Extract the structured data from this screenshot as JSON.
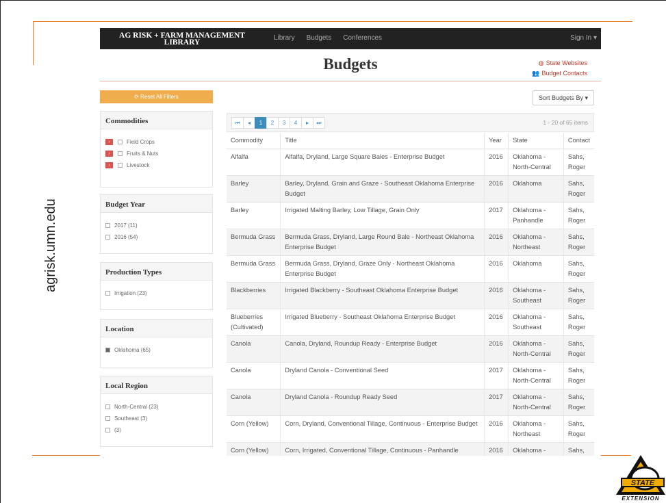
{
  "side_url": "agrisk.umn.edu",
  "logo": {
    "top": "STATE",
    "bottom": "EXTENSION",
    "mark": "O"
  },
  "navbar": {
    "brand_line1": "AG RISK + FARM MANAGEMENT",
    "brand_line2": "LIBRARY",
    "links": [
      "Library",
      "Budgets",
      "Conferences"
    ],
    "signin": "Sign In ▾"
  },
  "page": {
    "title": "Budgets",
    "state_websites": "State Websites",
    "budget_contacts": "Budget Contacts"
  },
  "sidebar": {
    "reset": "Reset All Filters",
    "commodities": {
      "title": "Commodities",
      "items": [
        "Field Crops",
        "Fruits & Nuts",
        "Livestock"
      ]
    },
    "budget_year": {
      "title": "Budget Year",
      "items": [
        "2017 (11)",
        "2016 (54)"
      ]
    },
    "production_types": {
      "title": "Production Types",
      "items": [
        "Irrigation (23)"
      ]
    },
    "location": {
      "title": "Location",
      "items": [
        "Oklahoma (65)"
      ]
    },
    "local_region": {
      "title": "Local Region",
      "items": [
        "North-Central (23)",
        "Southeast (3)",
        "(3)"
      ]
    }
  },
  "main": {
    "sort_label": "Sort Budgets By ▾",
    "pager": {
      "first": "⏮",
      "prev": "◂",
      "pages": [
        "1",
        "2",
        "3",
        "4"
      ],
      "next": "▸",
      "last": "⏭",
      "info": "1 - 20 of 65 items"
    },
    "columns": [
      "Commodity",
      "Title",
      "Year",
      "State",
      "Contact"
    ],
    "rows": [
      {
        "commodity": "Alfalfa",
        "title": "Alfalfa, Dryland, Large Square Bales - Enterprise Budget",
        "year": "2016",
        "state": "Oklahoma - North-Central",
        "contact": "Sahs, Roger"
      },
      {
        "commodity": "Barley",
        "title": "Barley, Dryland, Grain and Graze - Southeast Oklahoma Enterprise Budget",
        "year": "2016",
        "state": "Oklahoma",
        "contact": "Sahs, Roger"
      },
      {
        "commodity": "Barley",
        "title": "Irrigated Malting Barley, Low Tillage, Grain Only",
        "year": "2017",
        "state": "Oklahoma - Panhandle",
        "contact": "Sahs, Roger"
      },
      {
        "commodity": "Bermuda Grass",
        "title": "Bermuda Grass, Dryland, Large Round Bale - Northeast Oklahoma Enterprise Budget",
        "year": "2016",
        "state": "Oklahoma - Northeast",
        "contact": "Sahs, Roger"
      },
      {
        "commodity": "Bermuda Grass",
        "title": "Bermuda Grass, Dryland, Graze Only - Northeast Oklahoma Enterprise Budget",
        "year": "2016",
        "state": "Oklahoma",
        "contact": "Sahs, Roger"
      },
      {
        "commodity": "Blackberries",
        "title": "Irrigated Blackberry - Southeast Oklahoma Enterprise Budget",
        "year": "2016",
        "state": "Oklahoma - Southeast",
        "contact": "Sahs, Roger"
      },
      {
        "commodity": "Blueberries (Cultivated)",
        "title": "Irrigated Blueberry - Southeast Oklahoma Enterprise Budget",
        "year": "2016",
        "state": "Oklahoma - Southeast",
        "contact": "Sahs, Roger"
      },
      {
        "commodity": "Canola",
        "title": "Canola, Dryland, Roundup Ready - Enterprise Budget",
        "year": "2016",
        "state": "Oklahoma - North-Central",
        "contact": "Sahs, Roger"
      },
      {
        "commodity": "Canola",
        "title": "Dryland Canola - Conventional Seed",
        "year": "2017",
        "state": "Oklahoma - North-Central",
        "contact": "Sahs, Roger"
      },
      {
        "commodity": "Canola",
        "title": "Dryland Canola - Roundup Ready Seed",
        "year": "2017",
        "state": "Oklahoma - North-Central",
        "contact": "Sahs, Roger"
      },
      {
        "commodity": "Corn (Yellow)",
        "title": "Corn, Dryland, Conventional Tillage, Continuous - Enterprise Budget",
        "year": "2016",
        "state": "Oklahoma - Northeast",
        "contact": "Sahs, Roger"
      },
      {
        "commodity": "Corn (Yellow)",
        "title": "Corn, Irrigated, Conventional Tillage, Continuous - Panhandle",
        "year": "2016",
        "state": "Oklahoma -",
        "contact": "Sahs,"
      }
    ]
  },
  "colors": {
    "accent_orange": "#e87722",
    "reset_orange": "#f0ad4e",
    "link_red": "#c0392b",
    "nav_dark": "#222222",
    "pager_blue": "#3c8dbc"
  }
}
